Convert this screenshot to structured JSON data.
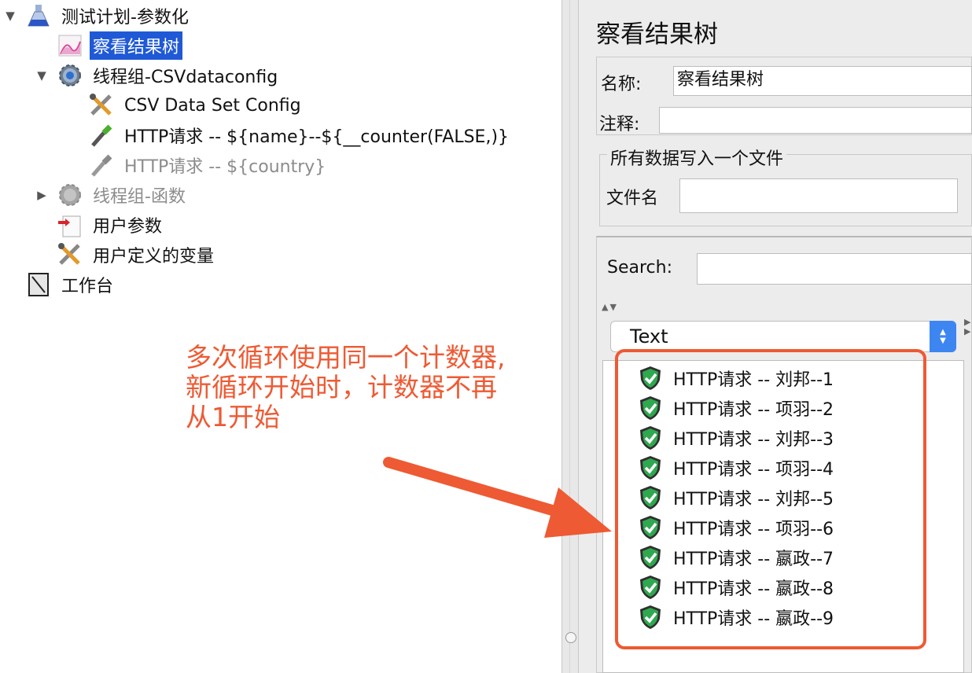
{
  "tree": {
    "nodes": [
      {
        "toggle": "▼",
        "icon": "flask-icon",
        "label": "测试计划-参数化",
        "state": "normal"
      },
      {
        "toggle": "",
        "icon": "graph-icon",
        "label": "察看结果树",
        "state": "selected"
      },
      {
        "toggle": "▼",
        "icon": "gear-icon",
        "label": "线程组-CSVdataconfig",
        "state": "normal"
      },
      {
        "toggle": "",
        "icon": "wrench-icon",
        "label": "CSV Data Set Config",
        "state": "normal"
      },
      {
        "toggle": "",
        "icon": "pipette-icon",
        "label": "HTTP请求 -- ${name}--${__counter(FALSE,)}",
        "state": "normal"
      },
      {
        "toggle": "",
        "icon": "pipette-icon",
        "label": "HTTP请求 -- ${country}",
        "state": "disabled"
      },
      {
        "toggle": "▶",
        "icon": "gear-icon",
        "label": "线程组-函数",
        "state": "disabled"
      },
      {
        "toggle": "",
        "icon": "user-params-icon",
        "label": "用户参数",
        "state": "normal"
      },
      {
        "toggle": "",
        "icon": "wrench-icon",
        "label": "用户定义的变量",
        "state": "normal"
      },
      {
        "toggle": "",
        "icon": "workbench-icon",
        "label": "工作台",
        "state": "normal"
      }
    ]
  },
  "panel": {
    "title": "察看结果树",
    "name_label": "名称:",
    "name_value": "察看结果树",
    "comment_label": "注释:",
    "comment_value": "",
    "fileset_legend": "所有数据写入一个文件",
    "filename_label": "文件名",
    "filename_value": "",
    "search_label": "Search:",
    "search_value": "",
    "renderer_selected": "Text"
  },
  "results": [
    {
      "icon": "success-shield-icon",
      "label": "HTTP请求 -- 刘邦--1"
    },
    {
      "icon": "success-shield-icon",
      "label": "HTTP请求 -- 项羽--2"
    },
    {
      "icon": "success-shield-icon",
      "label": "HTTP请求 -- 刘邦--3"
    },
    {
      "icon": "success-shield-icon",
      "label": "HTTP请求 -- 项羽--4"
    },
    {
      "icon": "success-shield-icon",
      "label": "HTTP请求 -- 刘邦--5"
    },
    {
      "icon": "success-shield-icon",
      "label": "HTTP请求 -- 项羽--6"
    },
    {
      "icon": "success-shield-icon",
      "label": "HTTP请求 -- 嬴政--7"
    },
    {
      "icon": "success-shield-icon",
      "label": "HTTP请求 -- 嬴政--8"
    },
    {
      "icon": "success-shield-icon",
      "label": "HTTP请求 -- 嬴政--9"
    }
  ],
  "annotation": {
    "lines": [
      "多次循环使用同一个计数器,",
      "新循环开始时，计数器不再",
      "从1开始"
    ],
    "color": "#ee5a33"
  },
  "colors": {
    "selection": "#1f59d6",
    "success": "#2fa84f",
    "combo_button": "#3d86f2"
  }
}
